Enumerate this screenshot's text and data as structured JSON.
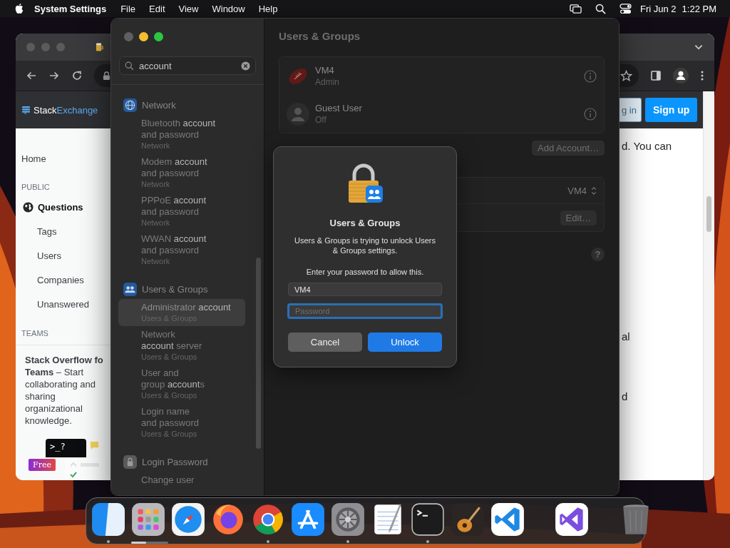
{
  "menu_bar": {
    "app_name": "System Settings",
    "menus": [
      "File",
      "Edit",
      "View",
      "Window",
      "Help"
    ],
    "date": "Fri Jun 2",
    "time": "1:22 PM"
  },
  "browser": {
    "header": {
      "logo_part_1": "Stack",
      "logo_part_2": "Exchange",
      "login": "g in",
      "signup": "Sign up"
    },
    "sidebar": {
      "home": {
        "label": "Home",
        "selected": false
      },
      "public_heading": "PUBLIC",
      "items": [
        {
          "label": "Questions",
          "selected": true
        },
        {
          "label": "Tags",
          "selected": false
        },
        {
          "label": "Users",
          "selected": false
        },
        {
          "label": "Companies",
          "selected": false
        },
        {
          "label": "Unanswered",
          "selected": false
        }
      ],
      "teams_heading": "TEAMS",
      "teams_text": "**Stack Overflow fo**\n**Teams** – Start collaborating and sharing organizational knowledge.",
      "promo_prompt": ">_?",
      "promo_badge": "Free"
    },
    "page_fragments": [
      "d. You can",
      "al",
      "d"
    ]
  },
  "settings": {
    "search": {
      "value": "account"
    },
    "results": [
      {
        "title": "Network",
        "items": [
          {
            "title": "Bluetooth **account**\nand password",
            "subtitle": "Network",
            "selected": false
          },
          {
            "title": "Modem **account**\nand password",
            "subtitle": "Network",
            "selected": false
          },
          {
            "title": "PPPoE **account**\nand password",
            "subtitle": "Network",
            "selected": false
          },
          {
            "title": "WWAN **account**\nand password",
            "subtitle": "Network",
            "selected": false
          }
        ]
      },
      {
        "title": "Users & Groups",
        "items": [
          {
            "title": "Administrator **account**",
            "subtitle": "Users & Groups",
            "selected": true
          },
          {
            "title": "Network\n**account** server",
            "subtitle": "Users & Groups",
            "selected": false
          },
          {
            "title": "User and\ngroup **account**s",
            "subtitle": "Users & Groups",
            "selected": false
          },
          {
            "title": "Login name\nand password",
            "subtitle": "Users & Groups",
            "selected": false
          }
        ]
      },
      {
        "title": "Login Password",
        "items": [
          {
            "title": "Change user",
            "selected": false
          }
        ]
      }
    ],
    "content": {
      "title": "Users & Groups",
      "users": [
        {
          "name": "VM4",
          "role": "Admin"
        },
        {
          "name": "Guest User",
          "role": "Off",
          "kind": "placeholder"
        }
      ],
      "add_button": "Add Account…",
      "auto_login_value": "VM4",
      "edit_button": "Edit…",
      "help_button": "?"
    }
  },
  "dialog": {
    "title": "Users & Groups",
    "message": "Users & Groups is trying to unlock Users & Groups settings.",
    "prompt": "Enter your password to allow this.",
    "username": "VM4",
    "password_placeholder": "Password",
    "password_focused": true,
    "buttons": [
      {
        "label": "Cancel",
        "kind": "secondary"
      },
      {
        "label": "Unlock",
        "kind": "primary"
      }
    ]
  },
  "dock": {
    "apps": [
      {
        "running": true
      },
      {
        "running": false,
        "level": 0.4
      },
      {
        "running": false
      },
      {
        "running": false
      },
      {
        "running": true
      },
      {
        "running": false
      },
      {
        "running": true
      },
      {
        "running": false
      },
      {
        "running": true
      },
      {
        "running": false
      },
      {
        "running": false
      }
    ],
    "recent": [
      {
        "running": false
      }
    ]
  }
}
